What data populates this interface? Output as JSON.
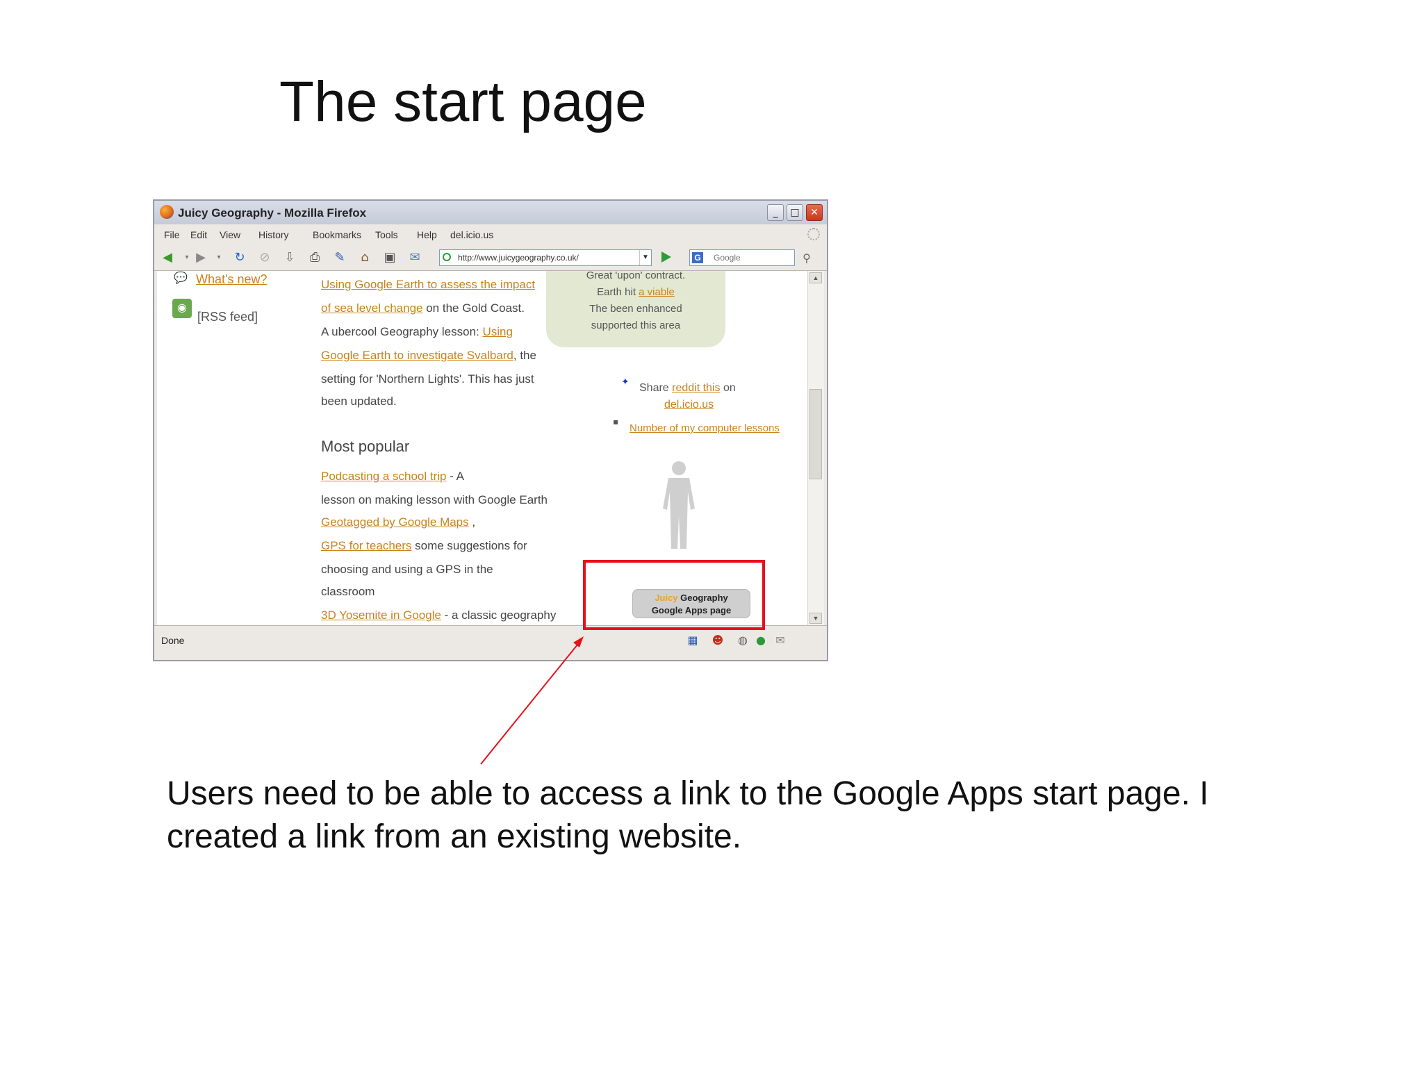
{
  "slide": {
    "title": "The start page",
    "caption": "Users need to be able to access a link to the Google Apps start page. I created a link from an existing website."
  },
  "browser": {
    "window_title": "Juicy Geography - Mozilla Firefox",
    "menu": [
      "File",
      "Edit",
      "View",
      "History",
      "Bookmarks",
      "Tools",
      "Help",
      "del.icio.us"
    ],
    "url": "http://www.juicygeography.co.uk/",
    "search_placeholder": "Google",
    "status": "Done"
  },
  "page": {
    "sidebar": {
      "whats_new": "What's new?",
      "rss": "[RSS feed]"
    },
    "main": {
      "line1_link": "Using Google Earth to assess the impact",
      "line2_link": "of sea level change",
      "line2_text": " on the Gold Coast.",
      "line3_text": "A ubercool Geography lesson: ",
      "line3_link": "Using",
      "line4_link": "Google Earth to investigate Svalbard",
      "line4_text": ", the",
      "line5_text": "setting for 'Northern Lights'. This has just",
      "line6_text": "been updated.",
      "most_popular": "Most popular",
      "pop1_link": "Podcasting a school trip",
      "pop1_text": " - A",
      "pop2_text": "lesson on making lesson with Google Earth",
      "pop3_link": "Geotagged by Google Maps",
      "pop3_text": " ,",
      "pop4_link": "GPS for teachers",
      "pop4_text": " some suggestions for",
      "pop5_text": "choosing and using a GPS in the",
      "pop6_text": "classroom",
      "pop7_link": "3D Yosemite in Google",
      "pop7_text": " - a classic geography"
    },
    "right": {
      "green_top": "Great 'upon' contract.",
      "green_l1_text": "Earth hit ",
      "green_l1_link": "a viable",
      "green_l2": "The been enhanced",
      "green_l3": "supported this area",
      "share_text1": "Share ",
      "share_link": "reddit this",
      "share_text2": " on",
      "share_link2": "del.icio.us",
      "teachers_link": "Number of my computer lessons",
      "apps_button_brand": "Juicy",
      "apps_button_line1_rest": " Geography",
      "apps_button_line2": "Google Apps page"
    }
  },
  "colors": {
    "link": "#c8821c",
    "highlight": "#e8101a",
    "green_panel": "#e3e8d3"
  },
  "icons": [
    "firefox-icon",
    "back-icon",
    "forward-icon",
    "reload-icon",
    "stop-icon",
    "home-icon",
    "print-icon",
    "go-icon",
    "search-icon",
    "rss-icon",
    "person-silhouette-icon"
  ]
}
